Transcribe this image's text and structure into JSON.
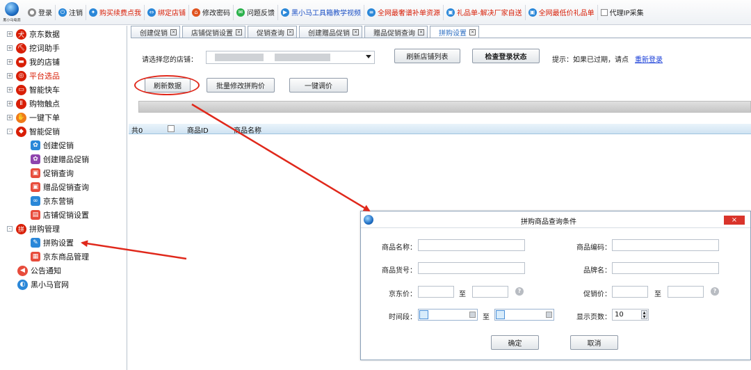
{
  "app": {
    "logo_text": "黑小马电商"
  },
  "toolbar": {
    "items": [
      {
        "label": "登录",
        "icon": "user-icon",
        "color": "#8a8a8a",
        "style": ""
      },
      {
        "label": "注销",
        "icon": "power-icon",
        "color": "#2a87d8",
        "style": ""
      },
      {
        "label": "购买续费点我",
        "icon": "cart-icon",
        "color": "#2a87d8",
        "style": "red"
      },
      {
        "label": "绑定店铺",
        "icon": "link-icon",
        "color": "#2a87d8",
        "style": "red"
      },
      {
        "label": "修改密码",
        "icon": "lock-icon",
        "color": "#e0531f",
        "style": ""
      },
      {
        "label": "问题反馈",
        "icon": "chat-icon",
        "color": "#2bb24c",
        "style": ""
      },
      {
        "label": "黑小马工具箱教学视频",
        "icon": "play-icon",
        "color": "#2a87d8",
        "style": "blue"
      },
      {
        "label": "全网最奢谱补单资源",
        "icon": "doc-icon",
        "color": "#2a87d8",
        "style": "red"
      },
      {
        "label": "礼品单-解决厂家自送",
        "icon": "gift-icon",
        "color": "#2a87d8",
        "style": "red"
      },
      {
        "label": "全网最低价礼品单",
        "icon": "gift-icon",
        "color": "#2a87d8",
        "style": "red"
      },
      {
        "label": "代理IP采集",
        "icon": "checkbox-icon",
        "color": "#999999",
        "style": ""
      }
    ]
  },
  "sidebar": {
    "items": [
      {
        "label": "京东数据",
        "icon": "jd-dog-icon",
        "color": "#d81e06",
        "level": 0,
        "expander": "+",
        "red": false
      },
      {
        "label": "挖词助手",
        "icon": "shovel-icon",
        "color": "#d81e06",
        "level": 0,
        "expander": "+",
        "red": false
      },
      {
        "label": "我的店铺",
        "icon": "shop-icon",
        "color": "#d81e06",
        "level": 0,
        "expander": "+",
        "red": false
      },
      {
        "label": "平台选品",
        "icon": "target-icon",
        "color": "#d81e06",
        "level": 0,
        "expander": "+",
        "red": true
      },
      {
        "label": "智能快车",
        "icon": "car-icon",
        "color": "#d81e06",
        "level": 0,
        "expander": "+",
        "red": false
      },
      {
        "label": "购物触点",
        "icon": "touch-icon",
        "color": "#d81e06",
        "level": 0,
        "expander": "+",
        "red": false
      },
      {
        "label": "一键下单",
        "icon": "hand-icon",
        "color": "#f07a1a",
        "level": 0,
        "expander": "+",
        "red": false
      },
      {
        "label": "智能促销",
        "icon": "tag-icon",
        "color": "#d81e06",
        "level": 0,
        "expander": "-",
        "red": false
      },
      {
        "label": "创建促销",
        "icon": "gear-icon",
        "color": "#2a87d8",
        "level": 1,
        "expander": "",
        "red": false
      },
      {
        "label": "创建赠品促销",
        "icon": "gift-gear-icon",
        "color": "#8e44ad",
        "level": 1,
        "expander": "",
        "red": false
      },
      {
        "label": "促销查询",
        "icon": "search-doc-icon",
        "color": "#e74c3c",
        "level": 1,
        "expander": "",
        "red": false
      },
      {
        "label": "赠品促销查询",
        "icon": "search-doc-icon",
        "color": "#e74c3c",
        "level": 1,
        "expander": "",
        "red": false
      },
      {
        "label": "京东营销",
        "icon": "infinity-icon",
        "color": "#2a87d8",
        "level": 1,
        "expander": "",
        "red": false
      },
      {
        "label": "店铺促销设置",
        "icon": "shop-setting-icon",
        "color": "#e74c3c",
        "level": 1,
        "expander": "",
        "red": false
      },
      {
        "label": "拼购管理",
        "icon": "group-buy-icon",
        "color": "#d81e06",
        "level": 0,
        "expander": "-",
        "red": false
      },
      {
        "label": "拼购设置",
        "icon": "wrench-icon",
        "color": "#2a87d8",
        "level": 1,
        "expander": "",
        "red": false
      },
      {
        "label": "京东商品管理",
        "icon": "box-icon",
        "color": "#e74c3c",
        "level": 1,
        "expander": "",
        "red": false
      },
      {
        "label": "公告通知",
        "icon": "speaker-icon",
        "color": "#e74c3c",
        "level": 0,
        "expander": "",
        "red": false
      },
      {
        "label": "黑小马官网",
        "icon": "horse-icon",
        "color": "#2a87d8",
        "level": 0,
        "expander": "",
        "red": false
      }
    ]
  },
  "tabs": [
    {
      "label": "创建促销",
      "active": false
    },
    {
      "label": "店铺促销设置",
      "active": false
    },
    {
      "label": "促销查询",
      "active": false
    },
    {
      "label": "创建赠品促销",
      "active": false
    },
    {
      "label": "赠品促销查询",
      "active": false
    },
    {
      "label": "拼购设置",
      "active": true
    }
  ],
  "main": {
    "shop_label": "请选择您的店铺：",
    "refresh_shops_btn": "刷新店铺列表",
    "check_login_btn": "检查登录状态",
    "tip_text": "提示：如果已过期，请点",
    "relogin_link": "重新登录",
    "refresh_data_btn": "刷新数据",
    "batch_modify_btn": "批量修改拼购价",
    "one_click_btn": "一键调价",
    "grid": {
      "count_label": "共0",
      "col_id": "商品ID",
      "col_name": "商品名称"
    }
  },
  "dialog": {
    "title": "拼购商品查询条件",
    "close_label": "×",
    "fields": {
      "name_label": "商品名称：",
      "code_label": "商品编码：",
      "sku_label": "商品货号：",
      "brand_label": "品牌名：",
      "jd_price_label": "京东价：",
      "promo_price_label": "促销价：",
      "to_label": "至",
      "period_label": "时间段：",
      "pages_label": "显示页数：",
      "pages_value": "10"
    },
    "ok_btn": "确定",
    "cancel_btn": "取消"
  }
}
